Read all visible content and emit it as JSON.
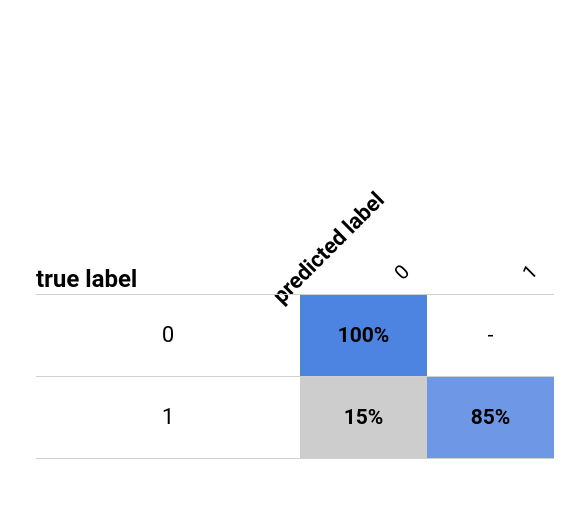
{
  "labels": {
    "true_label": "true label",
    "predicted_label": "predicted label"
  },
  "col_headers": [
    "0",
    "1"
  ],
  "row_headers": [
    "0",
    "1"
  ],
  "cells": {
    "r0c0": "100%",
    "r0c1": "-",
    "r1c0": "15%",
    "r1c1": "85%"
  },
  "chart_data": {
    "type": "heatmap",
    "title": "",
    "xlabel": "predicted label",
    "ylabel": "true label",
    "x_categories": [
      "0",
      "1"
    ],
    "y_categories": [
      "0",
      "1"
    ],
    "values": [
      [
        100,
        null
      ],
      [
        15,
        85
      ]
    ],
    "value_format": "percent",
    "cell_display": [
      [
        "100%",
        "-"
      ],
      [
        "15%",
        "85%"
      ]
    ],
    "color_scale": {
      "100": "#4e84e1",
      "85": "#6e98e5",
      "15": "#cdcdcd",
      "null": "#ffffff"
    }
  }
}
